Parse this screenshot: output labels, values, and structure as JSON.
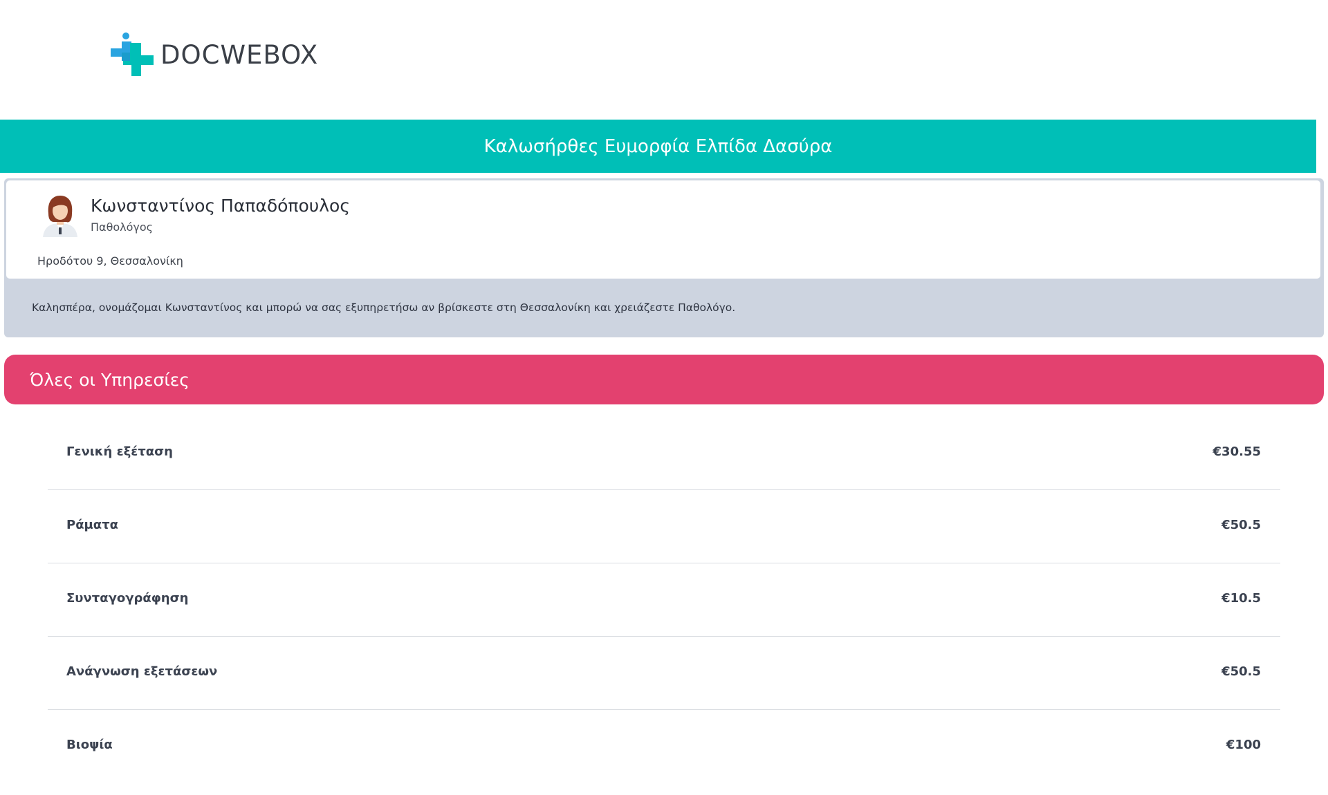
{
  "brand": {
    "name": "DOCWEBOX",
    "logo_icon": "medical-cross-logo-icon",
    "colors": {
      "teal": "#00bfb7",
      "blue": "#2aa4e0",
      "pink": "#e3416f",
      "card_gray": "#cdd4e0"
    }
  },
  "welcome": {
    "text": "Καλωσήρθες Ευμορφία Ελπίδα Δασύρα"
  },
  "doctor": {
    "name": "Κωνσταντίνος Παπαδόπουλος",
    "specialty": "Παθολόγος",
    "address": "Ηροδότου 9, Θεσσαλονίκη",
    "bio": "Καλησπέρα, ονομάζομαι Κωνσταντίνος και μπορώ να σας εξυπηρετήσω αν βρίσκεστε στη Θεσσαλονίκη και χρειάζεστε Παθολόγο.",
    "avatar_icon": "doctor-avatar-icon"
  },
  "services": {
    "title": "Όλες οι Υπηρεσίες",
    "items": [
      {
        "name": "Γενική εξέταση",
        "price": "€30.55"
      },
      {
        "name": "Ράματα",
        "price": "€50.5"
      },
      {
        "name": "Συνταγογράφηση",
        "price": "€10.5"
      },
      {
        "name": "Ανάγνωση εξετάσεων",
        "price": "€50.5"
      },
      {
        "name": "Βιοψία",
        "price": "€100"
      }
    ]
  }
}
